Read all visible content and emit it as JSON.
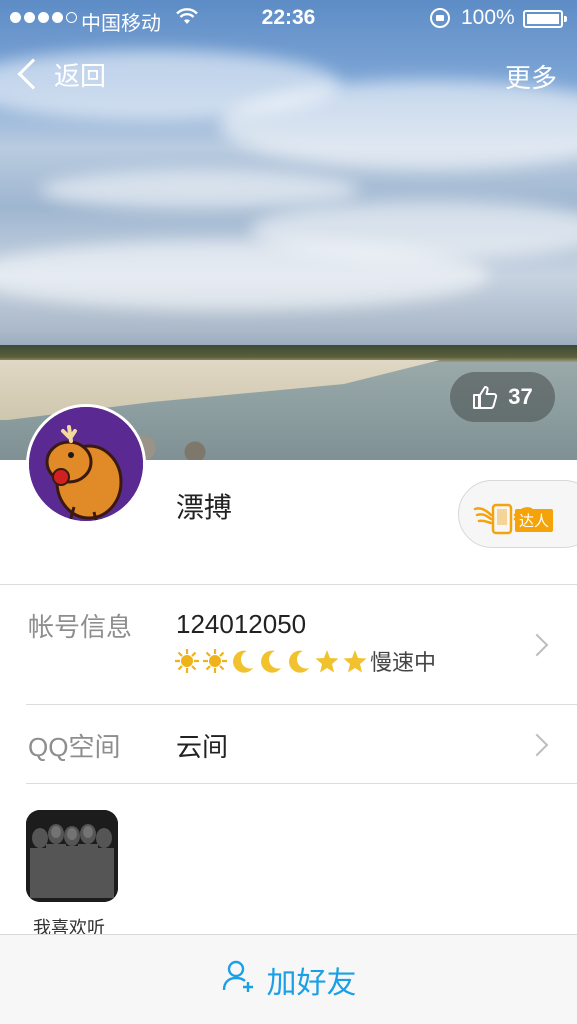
{
  "status_bar": {
    "carrier": "中国移动",
    "time": "22:36",
    "battery": "100%"
  },
  "nav": {
    "back_label": "返回",
    "more_label": "更多"
  },
  "cover": {
    "likes": "37"
  },
  "profile": {
    "nickname": "漂搏",
    "badge_label": "达人"
  },
  "account_row": {
    "label": "帐号信息",
    "qq_number": "124012050",
    "level_status": "慢速中",
    "level_icons": [
      "sun-icon",
      "sun-icon",
      "moon-icon",
      "moon-icon",
      "moon-icon",
      "star-icon",
      "star-icon"
    ]
  },
  "qzone_row": {
    "label": "QQ空间",
    "value": "云间"
  },
  "music": {
    "label": "我喜欢听"
  },
  "bottom_bar": {
    "add_friend_label": "加好友"
  }
}
